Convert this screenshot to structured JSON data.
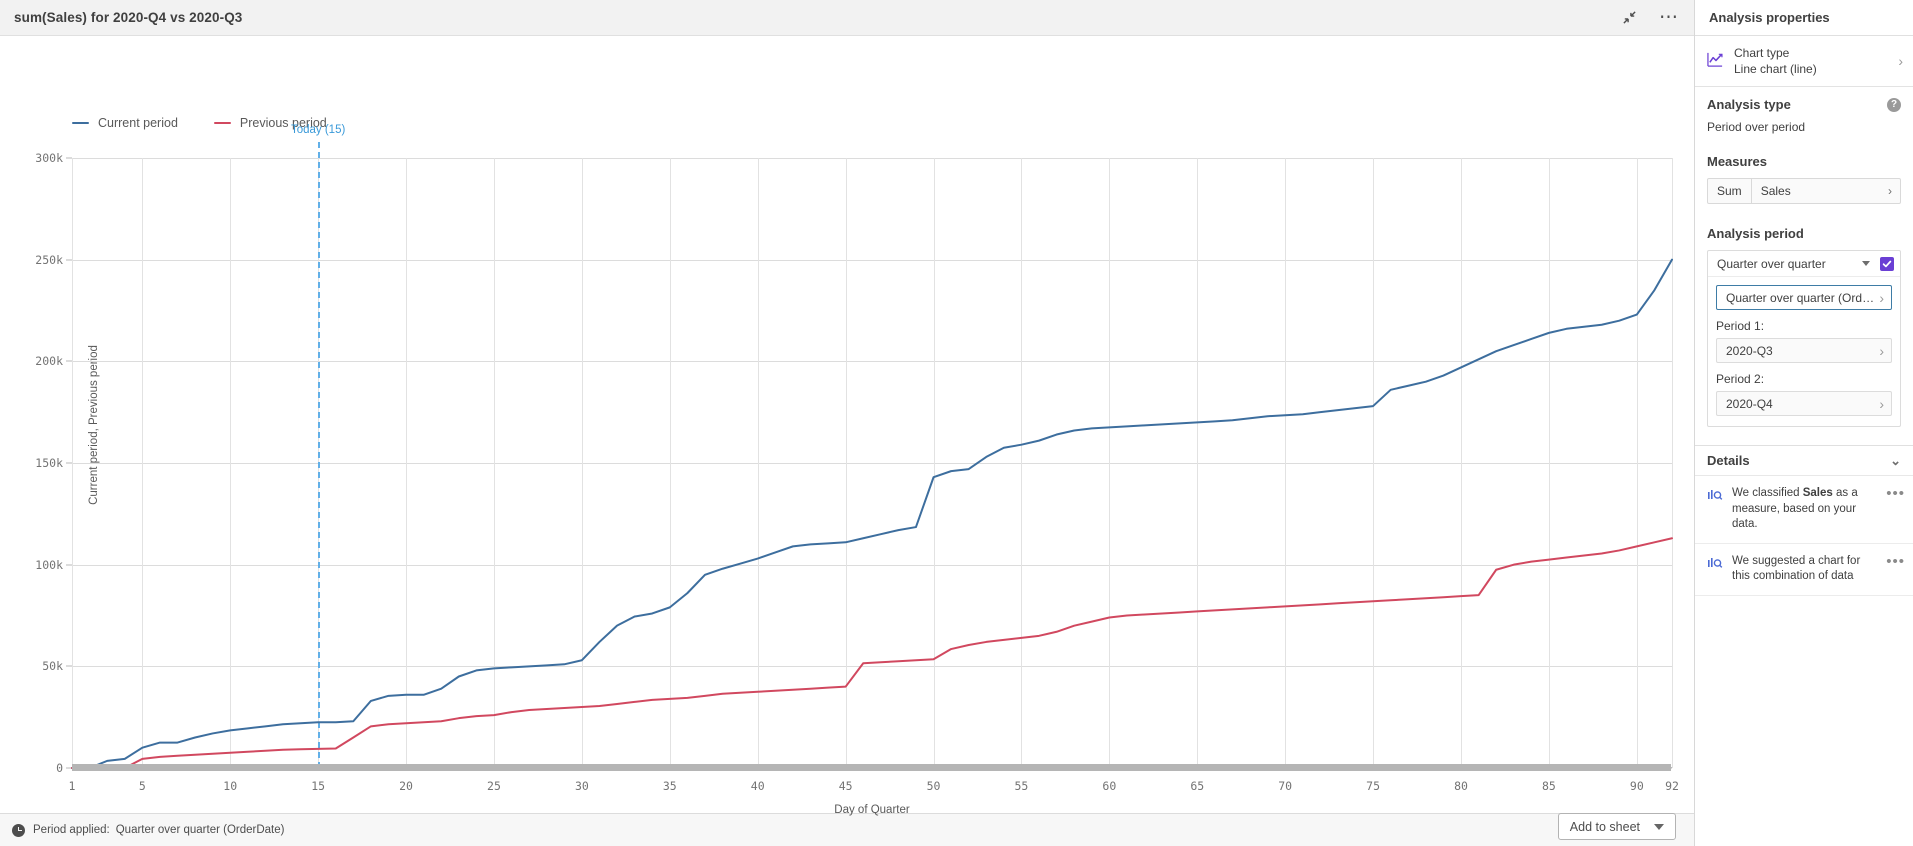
{
  "chart_panel": {
    "title": "sum(Sales) for 2020-Q4 vs 2020-Q3",
    "minimize_icon": "collapse-icon",
    "more_icon": "more-options-icon"
  },
  "status_bar": {
    "icon": "clock-icon",
    "label": "Period applied:",
    "value": "Quarter over quarter (OrderDate)",
    "add_to_sheet_label": "Add to sheet"
  },
  "panel": {
    "header": "Analysis properties",
    "chart_type": {
      "icon": "line-chart-icon",
      "label": "Chart type",
      "value": "Line chart (line)",
      "chevron": "chevron-right-icon"
    },
    "analysis_type": {
      "title": "Analysis type",
      "help_icon": "?",
      "value": "Period over period"
    },
    "measures": {
      "title": "Measures",
      "aggregation": "Sum",
      "field": "Sales",
      "chevron": "chevron-right-icon"
    },
    "analysis_period": {
      "title": "Analysis period",
      "selected": "Quarter over quarter",
      "checkbox_checked": true,
      "calendar_period": "Quarter over quarter (Order...",
      "period1_label": "Period 1:",
      "period1_value": "2020-Q3",
      "period2_label": "Period 2:",
      "period2_value": "2020-Q4"
    },
    "details": {
      "title": "Details",
      "items": [
        {
          "icon": "insight-icon",
          "text_pre": "We classified ",
          "text_bold": "Sales",
          "text_post": " as a measure, based on your data.",
          "menu": "•••"
        },
        {
          "icon": "insight-icon",
          "text_pre": "We suggested a chart for this combination of data",
          "text_bold": "",
          "text_post": "",
          "menu": "•••"
        }
      ]
    }
  },
  "colors": {
    "current_period": "#3d6e9e",
    "previous_period": "#d1485f",
    "today_line": "#62b0e8",
    "accent_purple": "#6a3fd4"
  },
  "chart_data": {
    "type": "line",
    "title": "sum(Sales) for 2020-Q4 vs 2020-Q3",
    "xlabel": "Day of Quarter",
    "ylabel": "Current period, Previous period",
    "xlim": [
      1,
      92
    ],
    "ylim": [
      0,
      300000
    ],
    "grid": true,
    "legend_position": "top-left",
    "ytick_labels": [
      "0",
      "50k",
      "100k",
      "150k",
      "200k",
      "250k",
      "300k"
    ],
    "ytick_values": [
      0,
      50000,
      100000,
      150000,
      200000,
      250000,
      300000
    ],
    "xtick_labels": [
      "1",
      "5",
      "10",
      "15",
      "20",
      "25",
      "30",
      "35",
      "40",
      "45",
      "50",
      "55",
      "60",
      "65",
      "70",
      "75",
      "80",
      "85",
      "90",
      "92"
    ],
    "xtick_values": [
      1,
      5,
      10,
      15,
      20,
      25,
      30,
      35,
      40,
      45,
      50,
      55,
      60,
      65,
      70,
      75,
      80,
      85,
      90,
      92
    ],
    "annotations": [
      {
        "label": "Today (15)",
        "x": 15,
        "type": "vertical-dashed-line"
      }
    ],
    "series": [
      {
        "name": "Current period",
        "color": "#3d6e9e",
        "x": [
          1,
          2,
          3,
          4,
          5,
          6,
          7,
          8,
          9,
          10,
          11,
          12,
          13,
          14,
          15,
          16,
          17,
          18,
          19,
          20,
          21,
          22,
          23,
          24,
          25,
          26,
          27,
          28,
          29,
          30,
          31,
          32,
          33,
          34,
          35,
          36,
          37,
          38,
          39,
          40,
          41,
          42,
          43,
          44,
          45,
          46,
          47,
          48,
          49,
          50,
          51,
          52,
          53,
          54,
          55,
          56,
          57,
          58,
          59,
          60,
          61,
          62,
          63,
          64,
          65,
          66,
          67,
          68,
          69,
          70,
          71,
          72,
          73,
          74,
          75,
          76,
          77,
          78,
          79,
          80,
          81,
          82,
          83,
          84,
          85,
          86,
          87,
          88,
          89,
          90,
          91,
          92
        ],
        "values": [
          0,
          0,
          3500,
          4500,
          10000,
          12500,
          12500,
          15000,
          17000,
          18500,
          19500,
          20500,
          21500,
          22000,
          22500,
          22500,
          23000,
          33000,
          35500,
          36000,
          36000,
          39000,
          45000,
          48000,
          49000,
          49500,
          50000,
          50500,
          51000,
          53000,
          62000,
          70000,
          74500,
          76000,
          79000,
          86000,
          95000,
          98000,
          100500,
          103000,
          106000,
          109000,
          110000,
          110500,
          111000,
          113000,
          115000,
          117000,
          118500,
          143000,
          146000,
          147000,
          153000,
          157500,
          159000,
          161000,
          164000,
          166000,
          167000,
          167500,
          168000,
          168500,
          169000,
          169500,
          170000,
          170500,
          171000,
          172000,
          173000,
          173500,
          174000,
          175000,
          176000,
          177000,
          178000,
          186000,
          188000,
          190000,
          193000,
          197000,
          201000,
          205000,
          208000,
          211000,
          214000,
          216000,
          217000,
          218000,
          220000,
          223000,
          235000,
          250000
        ]
      },
      {
        "name": "Previous period",
        "color": "#d1485f",
        "x": [
          1,
          2,
          3,
          4,
          5,
          6,
          7,
          8,
          9,
          10,
          11,
          12,
          13,
          14,
          15,
          16,
          17,
          18,
          19,
          20,
          21,
          22,
          23,
          24,
          25,
          26,
          27,
          28,
          29,
          30,
          31,
          32,
          33,
          34,
          35,
          36,
          37,
          38,
          39,
          40,
          41,
          42,
          43,
          44,
          45,
          46,
          47,
          48,
          49,
          50,
          51,
          52,
          53,
          54,
          55,
          56,
          57,
          58,
          59,
          60,
          61,
          62,
          63,
          64,
          65,
          66,
          67,
          68,
          69,
          70,
          71,
          72,
          73,
          74,
          75,
          76,
          77,
          78,
          79,
          80,
          81,
          82,
          83,
          84,
          85,
          86,
          87,
          88,
          89,
          90,
          91,
          92
        ],
        "values": [
          0,
          0,
          0,
          0,
          4500,
          5500,
          6000,
          6500,
          7000,
          7500,
          8000,
          8500,
          9000,
          9200,
          9400,
          9600,
          15000,
          20500,
          21500,
          22000,
          22500,
          23000,
          24500,
          25500,
          26000,
          27500,
          28500,
          29000,
          29500,
          30000,
          30500,
          31500,
          32500,
          33500,
          34000,
          34500,
          35500,
          36500,
          37000,
          37500,
          38000,
          38500,
          39000,
          39500,
          40000,
          51500,
          52000,
          52500,
          53000,
          53500,
          58500,
          60500,
          62000,
          63000,
          64000,
          65000,
          67000,
          70000,
          72000,
          74000,
          75000,
          75500,
          76000,
          76500,
          77000,
          77500,
          78000,
          78500,
          79000,
          79500,
          80000,
          80500,
          81000,
          81500,
          82000,
          82500,
          83000,
          83500,
          84000,
          84500,
          85000,
          97500,
          100000,
          101500,
          102500,
          103500,
          104500,
          105500,
          107000,
          109000,
          111000,
          113000
        ]
      }
    ]
  }
}
